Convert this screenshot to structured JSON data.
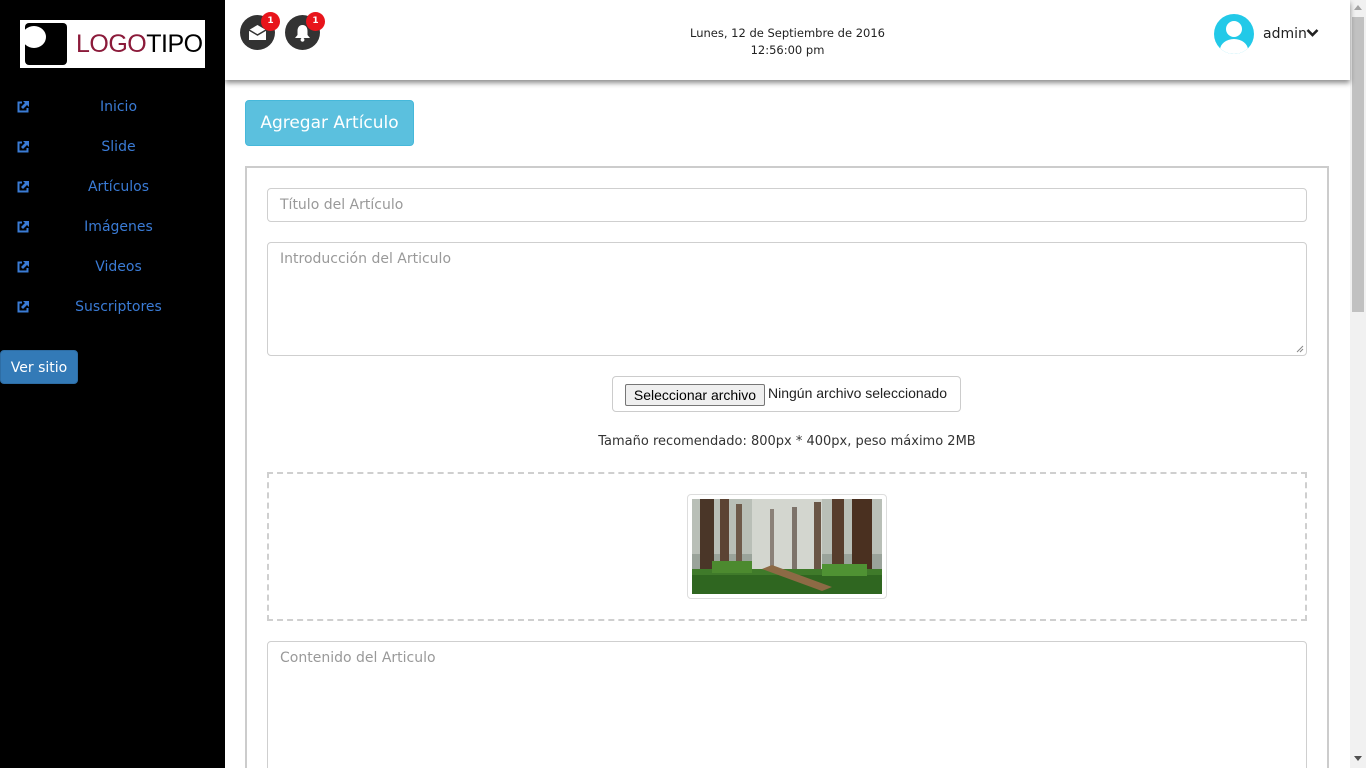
{
  "logo": {
    "text_1": "LOGO",
    "text_2": "TIPO"
  },
  "sidebar": {
    "items": [
      {
        "label": "Inicio",
        "icon": "external-link-icon"
      },
      {
        "label": "Slide",
        "icon": "external-link-icon"
      },
      {
        "label": "Artículos",
        "icon": "external-link-icon"
      },
      {
        "label": "Imágenes",
        "icon": "external-link-icon"
      },
      {
        "label": "Videos",
        "icon": "external-link-icon"
      },
      {
        "label": "Suscriptores",
        "icon": "external-link-icon"
      }
    ],
    "ver_sitio": "Ver sitio"
  },
  "header": {
    "messages_badge": "1",
    "notifications_badge": "1",
    "date": "Lunes, 12 de Septiembre de 2016",
    "time": "12:56:00 pm",
    "user": "admin"
  },
  "main": {
    "add_button": "Agregar Artículo",
    "title_placeholder": "Título del Artículo",
    "intro_placeholder": "Introducción del Articulo",
    "file_button": "Seleccionar archivo",
    "file_status": "Ningún archivo seleccionado",
    "hint": "Tamaño recomendado: 800px * 400px, peso máximo 2MB",
    "content_placeholder": "Contenido del Articulo"
  },
  "colors": {
    "sidebar_bg": "#000000",
    "link": "#3a7bd5",
    "primary": "#337ab7",
    "info": "#5bc0de",
    "badge": "#e8141b",
    "avatar": "#22c9e8"
  }
}
